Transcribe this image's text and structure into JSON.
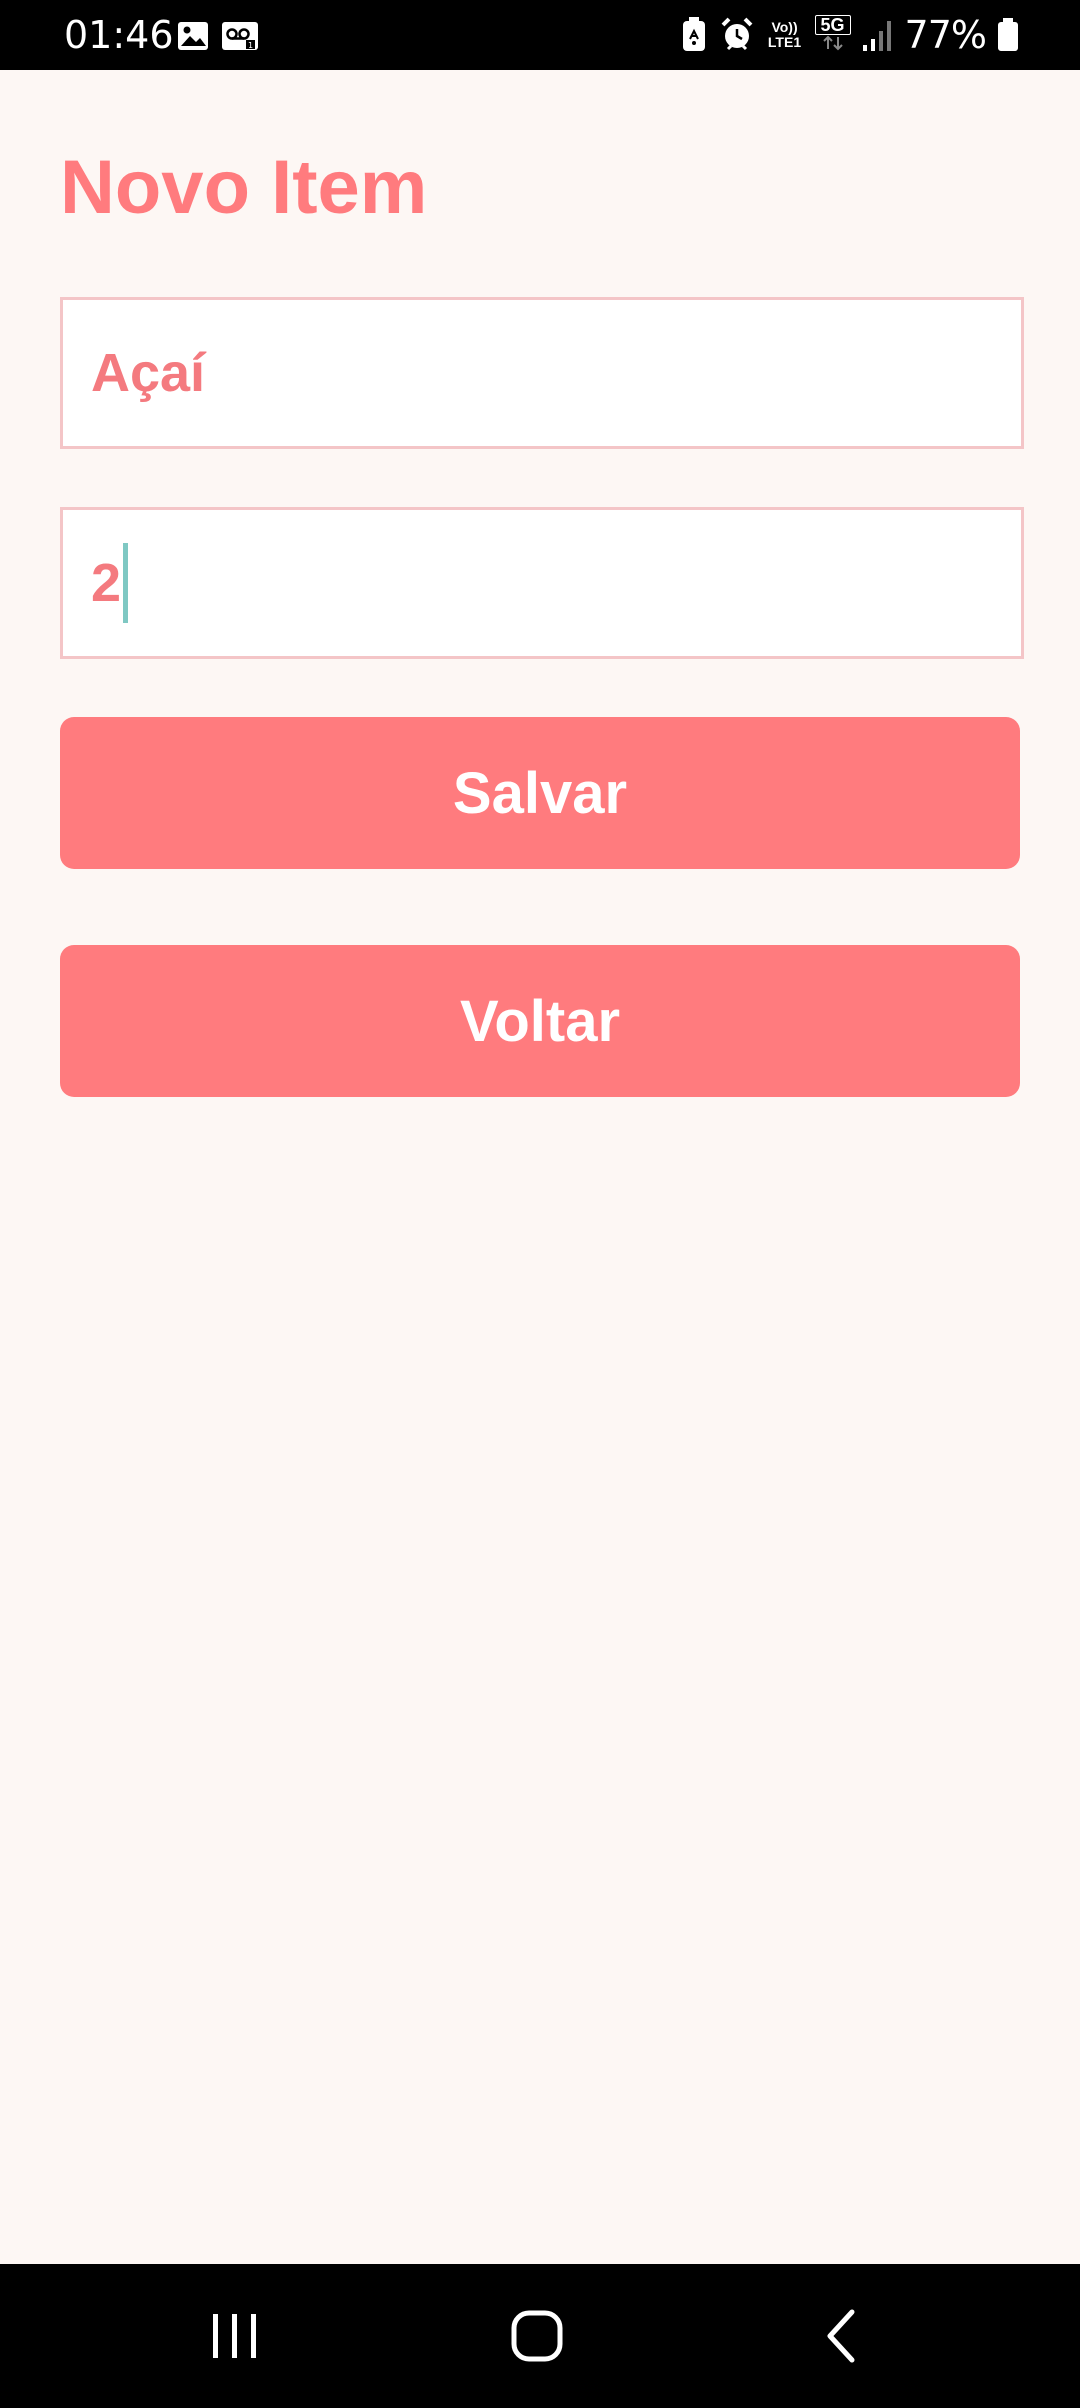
{
  "status_bar": {
    "time": "01:46",
    "network_top": "Vo))",
    "network_bottom": "LTE1",
    "fiveg": "5G",
    "battery_percent": "77%",
    "icons": [
      "image-icon",
      "voicemail-icon",
      "battery-saver-icon",
      "alarm-icon",
      "volte-icon",
      "5g-icon",
      "signal-icon",
      "battery-icon"
    ]
  },
  "page": {
    "title": "Novo Item"
  },
  "form": {
    "name_value": "Açaí",
    "quantity_value": "2"
  },
  "buttons": {
    "save_label": "Salvar",
    "back_label": "Voltar"
  },
  "nav_bar": {
    "icons": [
      "recent-apps-icon",
      "home-icon",
      "back-icon"
    ]
  },
  "colors": {
    "accent": "#ff7b7e",
    "background": "#fdf7f4",
    "field_border": "#f4c5c7",
    "caret": "#7fc8c3"
  }
}
